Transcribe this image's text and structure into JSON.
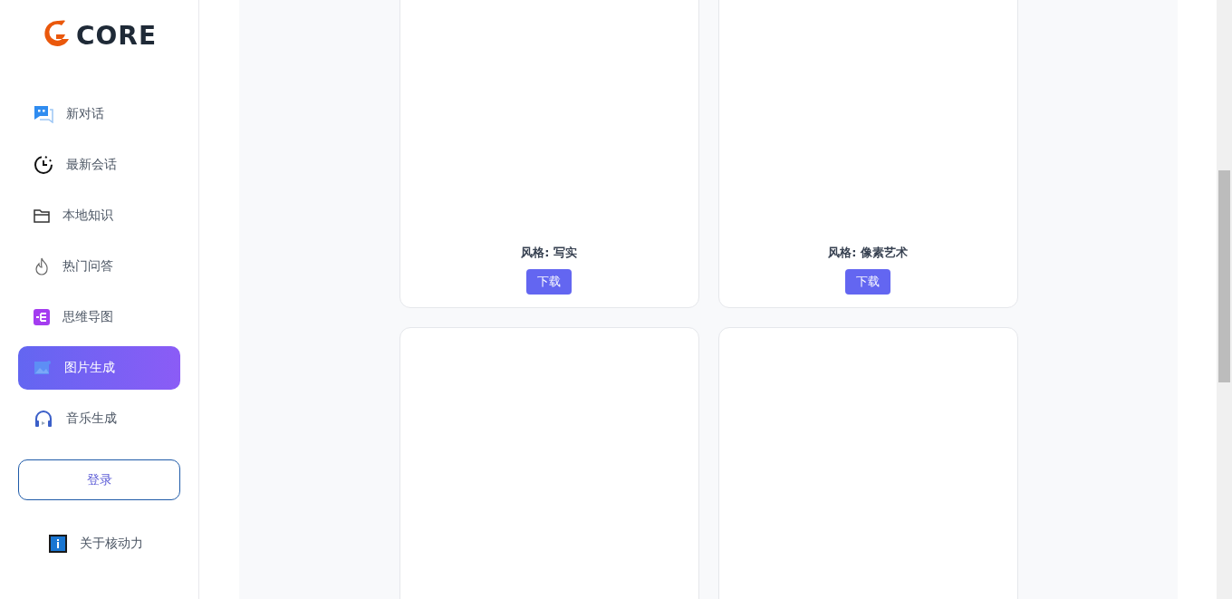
{
  "logo": {
    "text": "CORE"
  },
  "nav": [
    {
      "label": "新对话",
      "selected": false
    },
    {
      "label": "最新会话",
      "selected": false
    },
    {
      "label": "本地知识",
      "selected": false
    },
    {
      "label": "热门问答",
      "selected": false
    },
    {
      "label": "思维导图",
      "selected": false
    },
    {
      "label": "图片生成",
      "selected": true
    },
    {
      "label": "音乐生成",
      "selected": false
    }
  ],
  "login_button": "登录",
  "about": {
    "label": "关于核动力"
  },
  "cards": [
    {
      "kind": "result",
      "caption": "风格: 写实",
      "button": "下载"
    },
    {
      "kind": "result",
      "caption": "风格: 像素艺术",
      "button": "下载"
    },
    {
      "kind": "empty"
    },
    {
      "kind": "empty"
    }
  ]
}
